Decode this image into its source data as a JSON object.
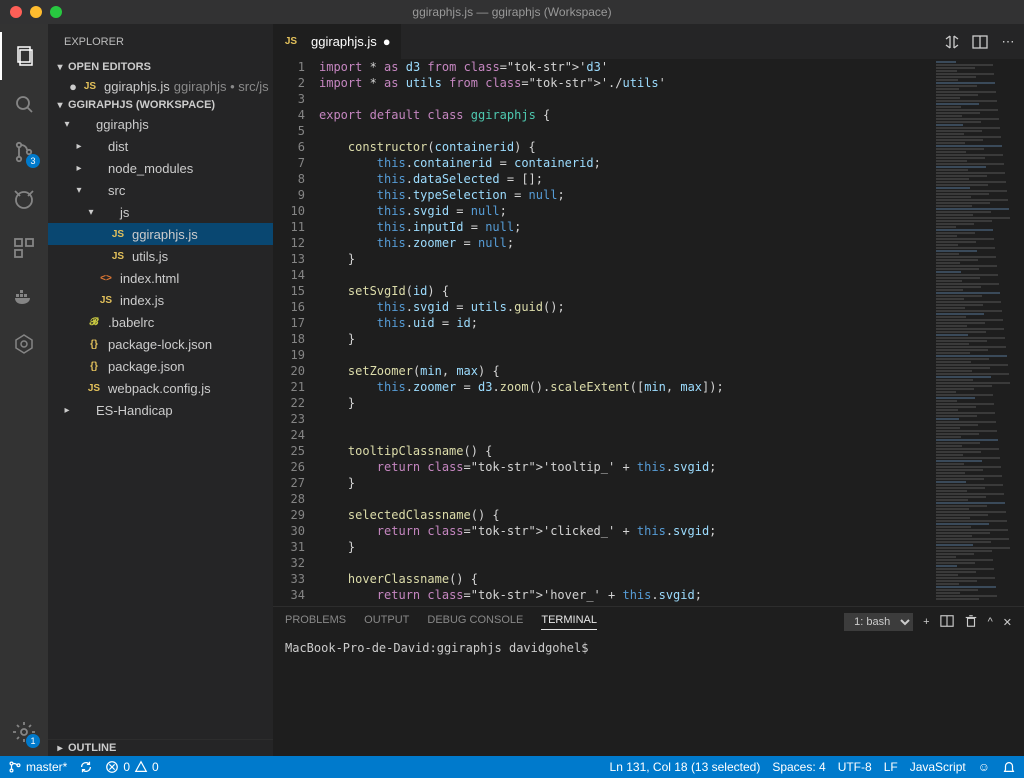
{
  "window": {
    "title": "ggiraphjs.js — ggiraphjs (Workspace)"
  },
  "sidebar": {
    "title": "EXPLORER",
    "sections": {
      "open_editors": "OPEN EDITORS",
      "workspace": "GGIRAPHJS (WORKSPACE)",
      "outline": "OUTLINE"
    },
    "open_editor": {
      "name": "ggiraphjs.js",
      "path": "ggiraphjs • src/js"
    },
    "tree": [
      {
        "depth": 0,
        "twist": "▾",
        "icon": "folder",
        "label": "ggiraphjs"
      },
      {
        "depth": 1,
        "twist": "▸",
        "icon": "folder",
        "label": "dist"
      },
      {
        "depth": 1,
        "twist": "▸",
        "icon": "folder",
        "label": "node_modules"
      },
      {
        "depth": 1,
        "twist": "▾",
        "icon": "folder",
        "label": "src"
      },
      {
        "depth": 2,
        "twist": "▾",
        "icon": "folder",
        "label": "js"
      },
      {
        "depth": 3,
        "twist": "",
        "icon": "js",
        "label": "ggiraphjs.js",
        "selected": true
      },
      {
        "depth": 3,
        "twist": "",
        "icon": "js",
        "label": "utils.js"
      },
      {
        "depth": 2,
        "twist": "",
        "icon": "html",
        "label": "index.html"
      },
      {
        "depth": 2,
        "twist": "",
        "icon": "js",
        "label": "index.js"
      },
      {
        "depth": 1,
        "twist": "",
        "icon": "babel",
        "label": ".babelrc"
      },
      {
        "depth": 1,
        "twist": "",
        "icon": "json",
        "label": "package-lock.json"
      },
      {
        "depth": 1,
        "twist": "",
        "icon": "json",
        "label": "package.json"
      },
      {
        "depth": 1,
        "twist": "",
        "icon": "js",
        "label": "webpack.config.js"
      },
      {
        "depth": 0,
        "twist": "▸",
        "icon": "folder",
        "label": "ES-Handicap"
      }
    ]
  },
  "activity": {
    "scm_badge": "3",
    "settings_badge": "1"
  },
  "tab": {
    "name": "ggiraphjs.js"
  },
  "editor": {
    "lines": [
      "import * as d3 from 'd3'",
      "import * as utils from './utils'",
      "",
      "export default class ggiraphjs {",
      "",
      "    constructor(containerid) {",
      "        this.containerid = containerid;",
      "        this.dataSelected = [];",
      "        this.typeSelection = null;",
      "        this.svgid = null;",
      "        this.inputId = null;",
      "        this.zoomer = null;",
      "    }",
      "",
      "    setSvgId(id) {",
      "        this.svgid = utils.guid();",
      "        this.uid = id;",
      "    }",
      "",
      "    setZoomer(min, max) {",
      "        this.zoomer = d3.zoom().scaleExtent([min, max]);",
      "    }",
      "",
      "",
      "    tooltipClassname() {",
      "        return 'tooltip_' + this.svgid;",
      "    }",
      "",
      "    selectedClassname() {",
      "        return 'clicked_' + this.svgid;",
      "    }",
      "",
      "    hoverClassname() {",
      "        return 'hover_' + this.svgid;"
    ]
  },
  "panel": {
    "tabs": [
      "PROBLEMS",
      "OUTPUT",
      "DEBUG CONSOLE",
      "TERMINAL"
    ],
    "active_tab": 3,
    "terminal_select": "1: bash",
    "terminal_line": "MacBook-Pro-de-David:ggiraphjs davidgohel$"
  },
  "status": {
    "branch": "master*",
    "sync": "",
    "errors": "0",
    "warnings": "0",
    "cursor": "Ln 131, Col 18 (13 selected)",
    "spaces": "Spaces: 4",
    "encoding": "UTF-8",
    "eol": "LF",
    "language": "JavaScript"
  },
  "icons": {
    "js": "JS",
    "json": "{}",
    "html": "<>"
  }
}
